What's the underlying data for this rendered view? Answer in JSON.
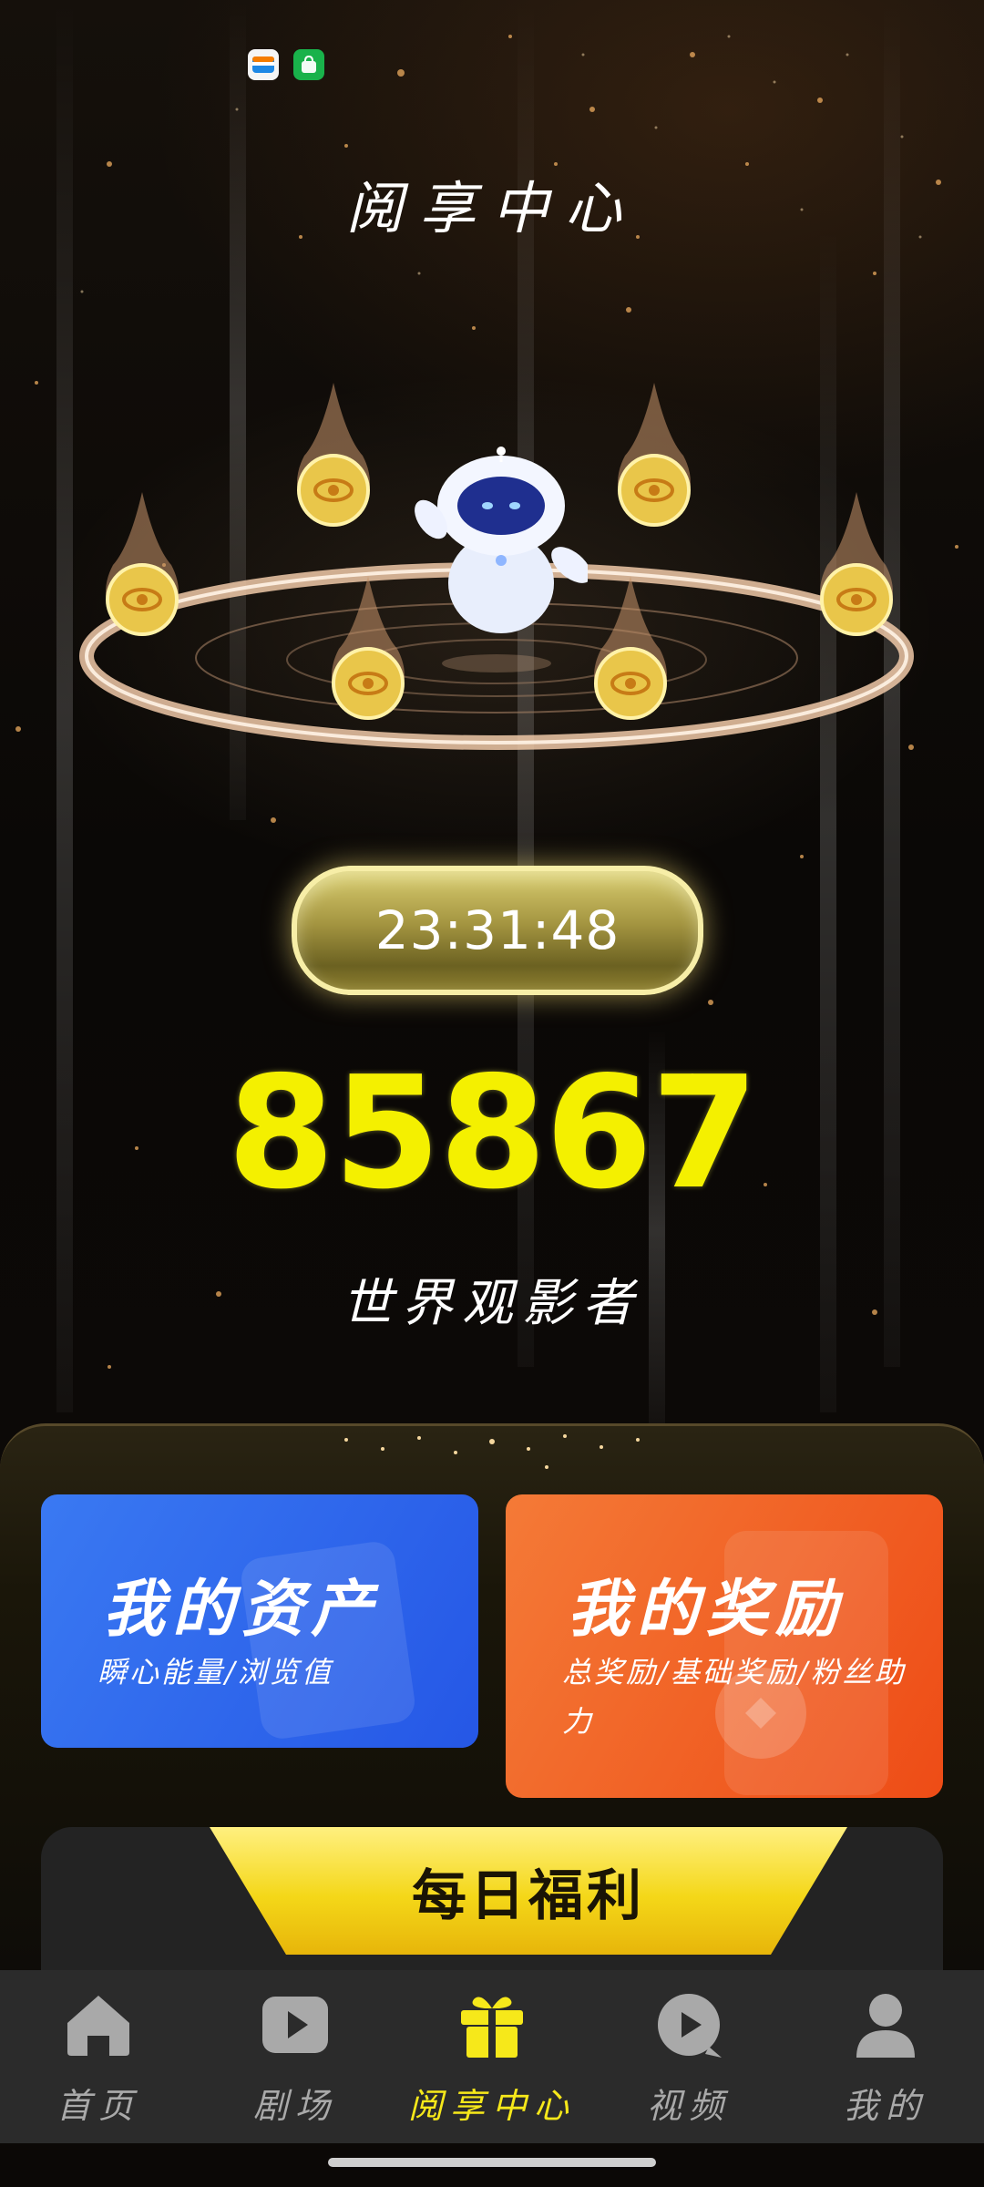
{
  "status_bar": {
    "icons": [
      "wallet-app-icon",
      "green-shopping-app-icon"
    ]
  },
  "page": {
    "title": "阅享中心"
  },
  "timer": {
    "value": "23:31:48"
  },
  "score": {
    "value": "85867",
    "rank_title": "世界观影者"
  },
  "cards": {
    "assets": {
      "title": "我的资产",
      "subtitle": "瞬心能量/浏览值"
    },
    "rewards": {
      "title": "我的奖励",
      "subtitle": "总奖励/基础奖励/粉丝助力"
    }
  },
  "daily": {
    "label": "每日福利"
  },
  "tabs": [
    {
      "label": "首页",
      "icon": "home-icon"
    },
    {
      "label": "剧场",
      "icon": "play-icon"
    },
    {
      "label": "阅享中心",
      "icon": "gift-icon",
      "active": true
    },
    {
      "label": "视频",
      "icon": "video-icon"
    },
    {
      "label": "我的",
      "icon": "profile-icon"
    }
  ],
  "colors": {
    "accent": "#f6e81a",
    "score": "#f4f000",
    "assets_card": "#2f68ee",
    "rewards_card": "#f06025",
    "tabbar": "#2b2b2b"
  }
}
